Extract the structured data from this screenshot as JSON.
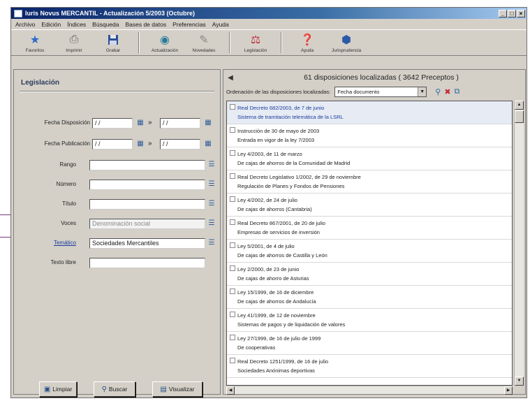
{
  "window": {
    "title": "Iuris Novus MERCANTIL - Actualización 5/2003 (Octubre)",
    "buttons": [
      "_",
      "□",
      "×"
    ]
  },
  "menu": [
    "Archivo",
    "Edición",
    "Índices",
    "Búsqueda",
    "Bases de datos",
    "Preferencias",
    "Ayuda"
  ],
  "toolbar": [
    {
      "label": "Favoritos",
      "icon": "star-icon"
    },
    {
      "label": "Imprimir",
      "icon": "printer-icon"
    },
    {
      "label": "Grabar",
      "icon": "save-icon"
    },
    {
      "label": "Actualización",
      "icon": "update-icon"
    },
    {
      "label": "Novedades",
      "icon": "news-icon"
    },
    {
      "label": "Legislación",
      "icon": "legislation-icon"
    },
    {
      "label": "Ayuda",
      "icon": "help-icon"
    },
    {
      "label": "Jurisprudencia",
      "icon": "jurisprudence-icon"
    }
  ],
  "left": {
    "title": "Legislación",
    "fields": {
      "fecha_disposicion": {
        "label": "Fecha Disposición",
        "from": "/ /",
        "to": "/ /"
      },
      "fecha_publicacion": {
        "label": "Fecha Publicación",
        "from": "/ /",
        "to": "/ /"
      },
      "rango": {
        "label": "Rango",
        "value": ""
      },
      "numero": {
        "label": "Número",
        "value": ""
      },
      "titulo": {
        "label": "Título",
        "value": ""
      },
      "voces": {
        "label": "Voces",
        "value": "Denominación social"
      },
      "tematico": {
        "label": "Temático",
        "value": "Sociedades Mercantiles"
      },
      "texto_libre": {
        "label": "Texto libre",
        "value": ""
      }
    },
    "buttons": {
      "limpiar": "Limpiar",
      "buscar": "Buscar",
      "visualizar": "Visualizar"
    }
  },
  "right": {
    "results_title": "61 disposiciones localizadas ( 3642 Preceptos )",
    "order_label": "Ordenación de las disposiciones localizadas:",
    "order_value": "Fecha documento",
    "items": [
      {
        "line1": "Real Decreto 682/2003, de 7 de junio",
        "line2": "Sistema de tramitación telemática de la LSRL",
        "selected": true
      },
      {
        "line1": "Instrucción de 30 de mayo de 2003",
        "line2": "Entrada en vigor de la ley 7/2003",
        "selected": false
      },
      {
        "line1": "Ley 4/2003, de 11 de marzo",
        "line2": "De cajas de ahorros de la Comunidad de Madrid",
        "selected": false
      },
      {
        "line1": "Real Decreto Legislativo 1/2002, de 29 de noviembre",
        "line2": "Regulación de Planes y Fondos de Pensiones",
        "selected": false
      },
      {
        "line1": "Ley 4/2002, de 24 de julio",
        "line2": "De cajas de ahorros (Cantabria)",
        "selected": false
      },
      {
        "line1": "Real Decreto 867/2001, de 20 de julio",
        "line2": "Empresas de servicios de inversión",
        "selected": false
      },
      {
        "line1": "Ley 5/2001, de 4 de julio",
        "line2": "De cajas de ahorros de Castilla y León",
        "selected": false
      },
      {
        "line1": "Ley 2/2000, de 23 de junio",
        "line2": "De cajas de ahorro de Asturias",
        "selected": false
      },
      {
        "line1": "Ley 15/1999, de 16 de diciembre",
        "line2": "De cajas de ahorros de Andalucía",
        "selected": false
      },
      {
        "line1": "Ley 41/1999, de 12 de noviembre",
        "line2": "Sistemas de pagos y de liquidación de valores",
        "selected": false
      },
      {
        "line1": "Ley 27/1999, de 16 de julio de 1999",
        "line2": "De cooperativas",
        "selected": false
      },
      {
        "line1": "Real Decreto 1251/1999, de 16 de julio",
        "line2": "Sociedades Anónimas deportivas",
        "selected": false
      }
    ]
  }
}
